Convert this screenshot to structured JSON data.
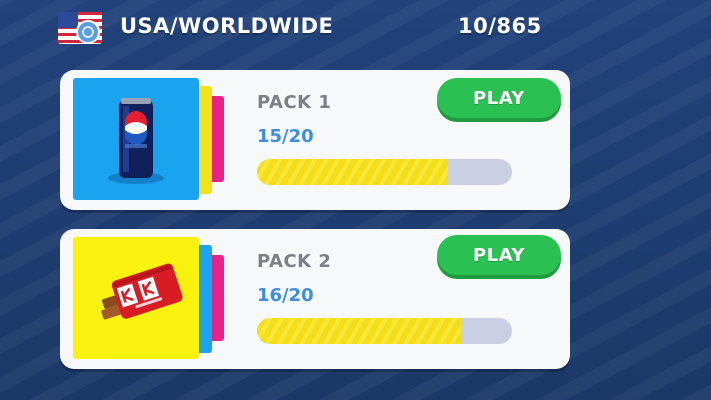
{
  "header": {
    "region": "USA/WORLDWIDE",
    "progress": "10/865",
    "flag_icon": "usa-un-flag-icon"
  },
  "packs": [
    {
      "title": "PACK 1",
      "progress_text": "15/20",
      "progress_fraction": 0.75,
      "play_label": "PLAY",
      "image_icon": "pepsi-can-icon",
      "front_color": "#1aa3ee"
    },
    {
      "title": "PACK 2",
      "progress_text": "16/20",
      "progress_fraction": 0.8,
      "play_label": "PLAY",
      "image_icon": "kitkat-bar-icon",
      "front_color": "#f8f20e"
    }
  ],
  "colors": {
    "background": "#1d3c70",
    "play_button": "#2bc152",
    "progress_fill": "#f3de19",
    "progress_track": "#cbcfe4",
    "progress_text": "#3c8fe0"
  }
}
